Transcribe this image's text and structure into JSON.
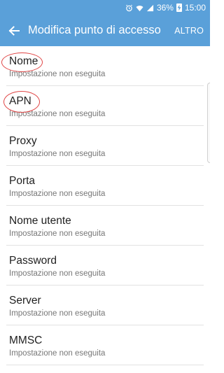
{
  "status_bar": {
    "battery": "36%",
    "time": "15:00",
    "icons": [
      "alarm-icon",
      "wifi-icon",
      "signal-icon",
      "battery-icon"
    ]
  },
  "app_bar": {
    "title": "Modifica punto di accesso",
    "more_label": "ALTRO"
  },
  "colors": {
    "app_bar": "#5aa0d9",
    "annotation": "#e04545"
  },
  "fields": [
    {
      "label": "Nome",
      "value": "Impostazione non eseguita"
    },
    {
      "label": "APN",
      "value": "Impostazione non eseguita"
    },
    {
      "label": "Proxy",
      "value": "Impostazione non eseguita"
    },
    {
      "label": "Porta",
      "value": "Impostazione non eseguita"
    },
    {
      "label": "Nome utente",
      "value": "Impostazione non eseguita"
    },
    {
      "label": "Password",
      "value": "Impostazione non eseguita"
    },
    {
      "label": "Server",
      "value": "Impostazione non eseguita"
    },
    {
      "label": "MMSC",
      "value": "Impostazione non eseguita"
    }
  ]
}
